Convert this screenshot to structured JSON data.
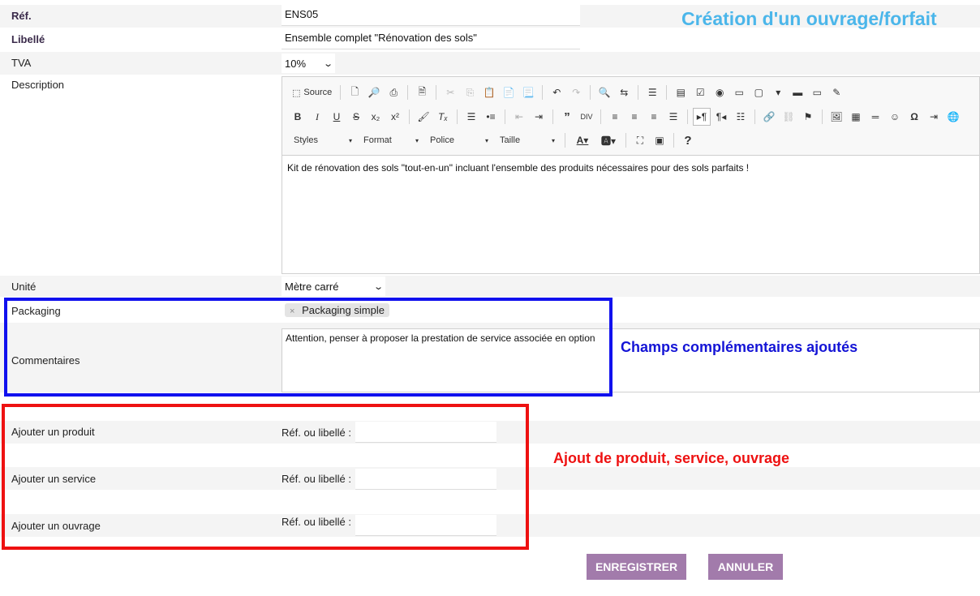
{
  "annotations": {
    "title": "Création d'un ouvrage/forfait",
    "blue_caption": "Champs complémentaires ajoutés",
    "red_caption": "Ajout de produit, service, ouvrage"
  },
  "form": {
    "ref": {
      "label": "Réf.",
      "value": "ENS05"
    },
    "libelle": {
      "label": "Libellé",
      "value": "Ensemble complet \"Rénovation des sols\""
    },
    "tva": {
      "label": "TVA",
      "value": "10%"
    },
    "description": {
      "label": "Description",
      "source_label": "Source",
      "styles_label": "Styles",
      "format_label": "Format",
      "police_label": "Police",
      "taille_label": "Taille",
      "text": "Kit de rénovation des sols \"tout-en-un\" incluant l'ensemble des produits nécessaires pour des sols parfaits !"
    },
    "unite": {
      "label": "Unité",
      "value": "Mètre carré"
    },
    "packaging": {
      "label": "Packaging",
      "tag": "Packaging simple",
      "tag_remove": "×"
    },
    "commentaires": {
      "label": "Commentaires",
      "value": "Attention, penser à proposer la prestation de service associée en option"
    },
    "add_produit": {
      "label": "Ajouter un produit",
      "search_label": "Réf. ou libellé :"
    },
    "add_service": {
      "label": "Ajouter un service",
      "search_label": "Réf. ou libellé :"
    },
    "add_ouvrage": {
      "label": "Ajouter un ouvrage",
      "search_label": "Réf. ou libellé :"
    }
  },
  "buttons": {
    "save": "ENREGISTRER",
    "cancel": "ANNULER"
  },
  "colors": {
    "button": "#a27bab",
    "title_annotation": "#4bb6ea",
    "blue_box": "#1111ee",
    "red_box": "#ee1111"
  }
}
